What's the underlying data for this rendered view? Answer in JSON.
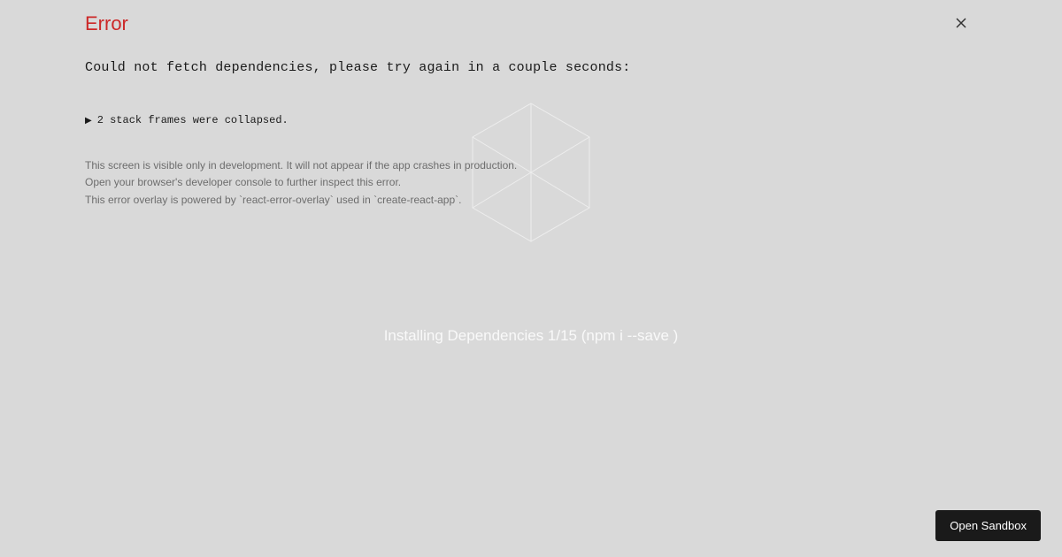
{
  "error": {
    "title": "Error",
    "message": "Could not fetch dependencies, please try again in a couple seconds:",
    "stack_frames_label": "2 stack frames were collapsed.",
    "notice_line1": "This screen is visible only in development. It will not appear if the app crashes in production.",
    "notice_line2": "Open your browser's developer console to further inspect this error.",
    "notice_line3": "This error overlay is powered by `react-error-overlay` used in `create-react-app`."
  },
  "loader": {
    "status_text": "Installing Dependencies 1/15 (npm i --save )"
  },
  "buttons": {
    "open_sandbox": "Open Sandbox"
  }
}
